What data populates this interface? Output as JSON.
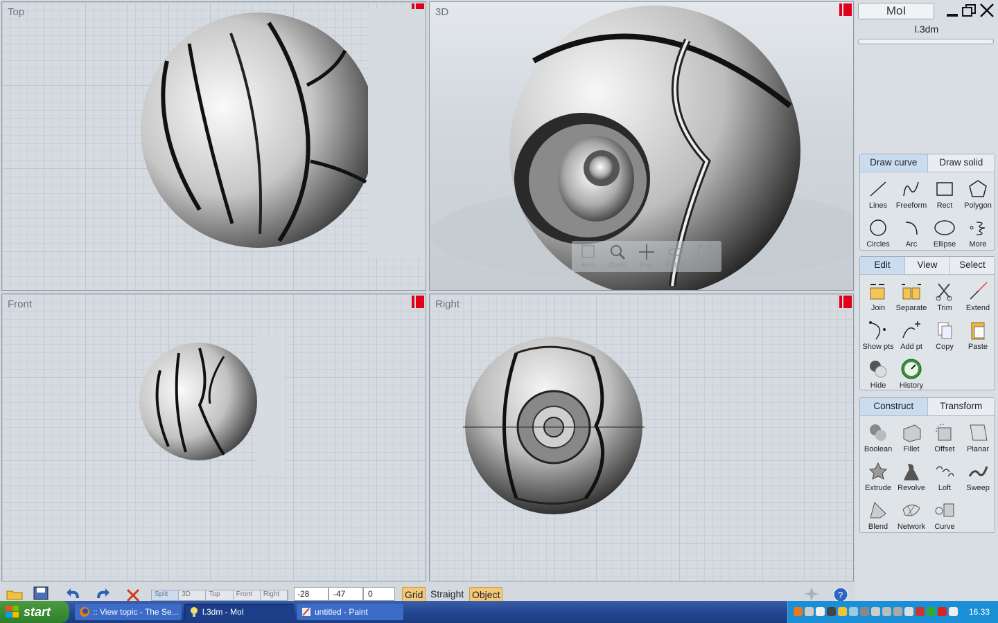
{
  "viewports": {
    "top": {
      "title": "Top"
    },
    "persp": {
      "title": "3D"
    },
    "front": {
      "title": "Front"
    },
    "right": {
      "title": "Right"
    }
  },
  "nav_tools": [
    {
      "label": "Area",
      "icon": "zoom-area-icon"
    },
    {
      "label": "Zoom",
      "icon": "zoom-icon"
    },
    {
      "label": "Pan",
      "icon": "pan-icon"
    },
    {
      "label": "Rotate",
      "icon": "rotate-icon"
    },
    {
      "label": "Reset",
      "icon": "reset-icon"
    }
  ],
  "panel": {
    "title": "MoI",
    "file_name": "l.3dm",
    "draw": {
      "tabs": [
        "Draw curve",
        "Draw solid"
      ],
      "tools": [
        "Lines",
        "Freeform",
        "Rect",
        "Polygon",
        "Circles",
        "Arc",
        "Ellipse",
        "More"
      ]
    },
    "edit": {
      "tabs": [
        "Edit",
        "View",
        "Select"
      ],
      "tools": [
        "Join",
        "Separate",
        "Trim",
        "Extend",
        "Show pts",
        "Add pt",
        "Copy",
        "Paste",
        "Hide",
        "History"
      ]
    },
    "construct": {
      "tabs": [
        "Construct",
        "Transform"
      ],
      "tools": [
        "Boolean",
        "Fillet",
        "Offset",
        "Planar",
        "Extrude",
        "Revolve",
        "Loft",
        "Sweep",
        "Blend",
        "Network",
        "Curve"
      ]
    }
  },
  "bottombar": {
    "view_tabs": [
      "Split",
      "3D",
      "Top",
      "Front",
      "Right"
    ],
    "coords": {
      "x": "-28",
      "y": "-47",
      "z": "0"
    },
    "grid_label": "Grid",
    "straight_label": "Straight",
    "object_label": "Object"
  },
  "taskbar": {
    "start_label": "start",
    "items": [
      ":: View topic - The Se...",
      "l.3dm - MoI",
      "untitled - Paint"
    ],
    "clock": "16.33"
  },
  "colors": {
    "accent_tab": "#c9dcf0",
    "max_icon": "#e0001a",
    "toggle_on": "#f3c87a",
    "taskbar": "#20448f"
  }
}
